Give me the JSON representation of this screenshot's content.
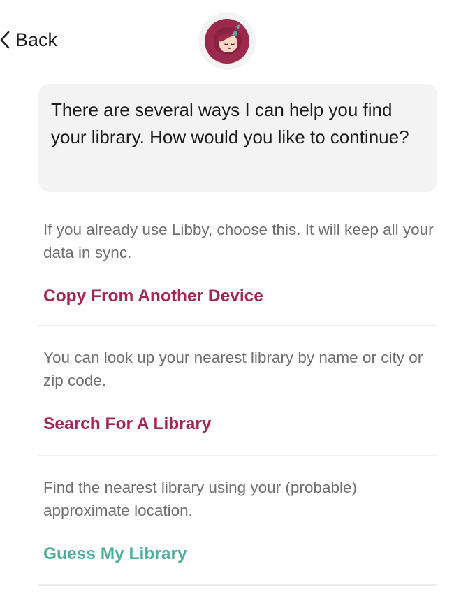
{
  "header": {
    "back_label": "Back",
    "avatar_icon": "libby-mascot-icon"
  },
  "message": {
    "text": "There are several ways I can help you find your library. How would you like to continue?"
  },
  "options": [
    {
      "description": "If you already use Libby, choose this. It will keep all your data in sync.",
      "action_label": "Copy From Another Device",
      "action_color": "#a52551"
    },
    {
      "description": "You can look up your nearest library by name or city or zip code.",
      "action_label": "Search For A Library",
      "action_color": "#a52551"
    },
    {
      "description": "Find the nearest library using your (probable) approximate location.",
      "action_label": "Guess My Library",
      "action_color": "#4fae9e"
    }
  ],
  "colors": {
    "brand_primary": "#a52551",
    "brand_secondary": "#4fae9e",
    "mascot_hair": "#9c2a4c",
    "mascot_skin": "#f7d9c4",
    "bubble_bg": "#f3f3f3",
    "divider": "#ececec"
  }
}
